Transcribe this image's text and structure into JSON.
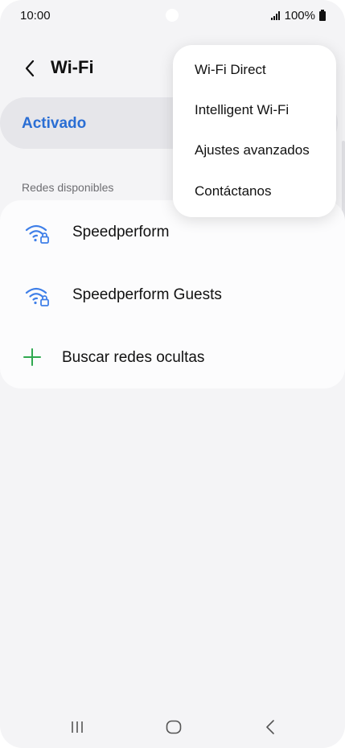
{
  "status_bar": {
    "time": "10:00",
    "battery": "100%",
    "signal_icon": "signal-icon",
    "battery_icon": "battery-icon"
  },
  "header": {
    "back_icon": "chevron-left-icon",
    "title": "Wi-Fi"
  },
  "wifi_toggle": {
    "label": "Activado",
    "state": true,
    "accent_color": "#2a6ed4"
  },
  "networks_section": {
    "label": "Redes disponibles",
    "networks": [
      {
        "name": "Speedperform",
        "icon": "wifi-locked-icon"
      },
      {
        "name": "Speedperform Guests",
        "icon": "wifi-locked-icon"
      }
    ],
    "hidden_action": {
      "label": "Buscar redes ocultas",
      "icon": "plus-icon"
    }
  },
  "overflow_menu": {
    "items": [
      {
        "label": "Wi-Fi Direct"
      },
      {
        "label": "Intelligent Wi-Fi"
      },
      {
        "label": "Ajustes avanzados"
      },
      {
        "label": "Contáctanos"
      }
    ]
  },
  "nav_bar": {
    "recents_icon": "recents-icon",
    "home_icon": "home-icon",
    "back_icon": "back-icon"
  }
}
